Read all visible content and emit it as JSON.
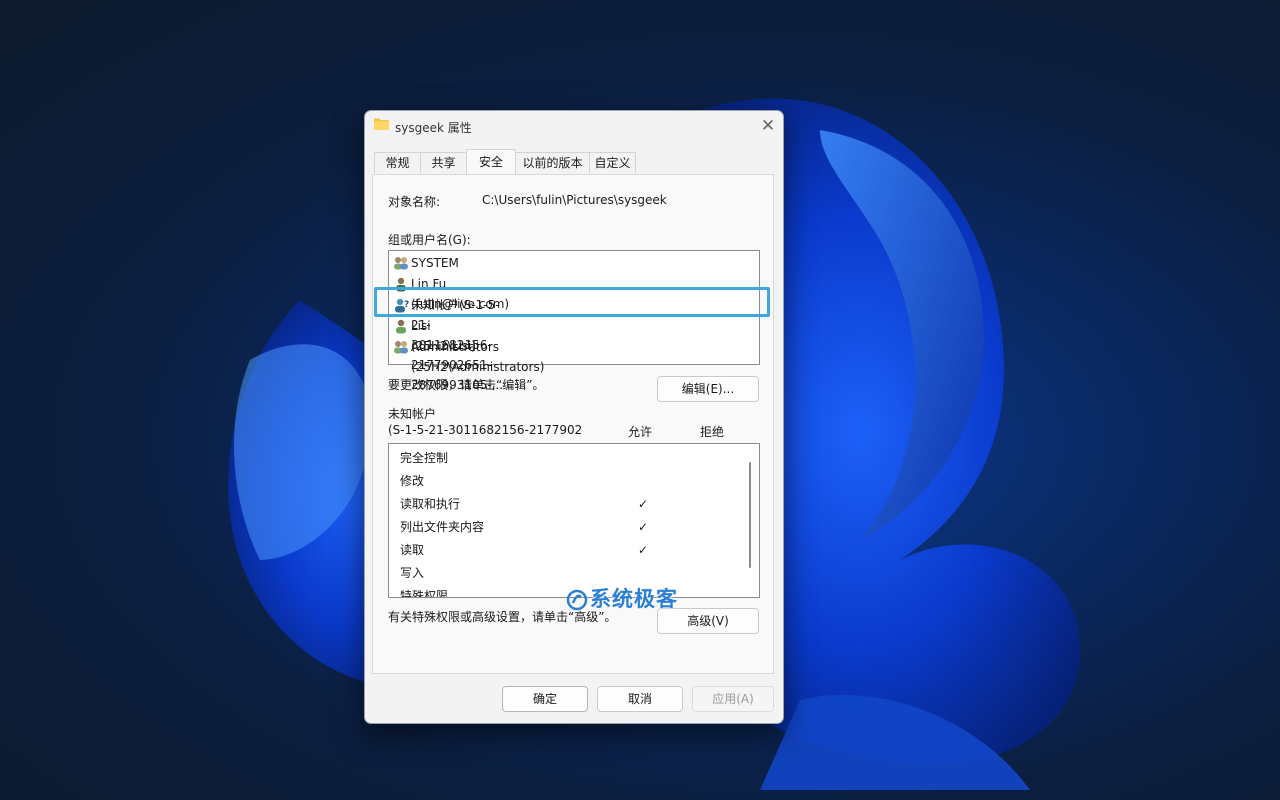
{
  "window": {
    "title": "sysgeek 属性",
    "close_glyph": "✕"
  },
  "tabs": [
    {
      "label": "常规"
    },
    {
      "label": "共享"
    },
    {
      "label": "安全",
      "active": true
    },
    {
      "label": "以前的版本"
    },
    {
      "label": "自定义"
    }
  ],
  "security": {
    "object_name_label": "对象名称:",
    "object_name_value": "C:\\Users\\fulin\\Pictures\\sysgeek",
    "group_label": "组或用户名(G):",
    "users": [
      {
        "label": "SYSTEM",
        "icon": "group-icon"
      },
      {
        "label": "Lin Fu (fulin@live.com)",
        "icon": "user-icon"
      },
      {
        "label": "未知帐户(S-1-5-21-3011682156-2177902651-2876993105-...",
        "icon": "unknown-user-icon",
        "selected": true
      },
      {
        "label": "Lisi (25H2\\Lisi)",
        "icon": "user-icon"
      },
      {
        "label": "Administrators (25H2\\Administrators)",
        "icon": "group-icon"
      }
    ],
    "change_hint": "要更改权限，请单击“编辑”。",
    "edit_button": "编辑(E)...",
    "perm_for_line1": "未知帐户",
    "perm_for_line2": "(S-1-5-21-3011682156-2177902",
    "allow_header": "允许",
    "deny_header": "拒绝",
    "permissions": [
      {
        "label": "完全控制",
        "allow": "",
        "deny": ""
      },
      {
        "label": "修改",
        "allow": "",
        "deny": ""
      },
      {
        "label": "读取和执行",
        "allow": "✓",
        "deny": ""
      },
      {
        "label": "列出文件夹内容",
        "allow": "✓",
        "deny": ""
      },
      {
        "label": "读取",
        "allow": "✓",
        "deny": ""
      },
      {
        "label": "写入",
        "allow": "",
        "deny": ""
      },
      {
        "label": "特殊权限",
        "allow": "",
        "deny": ""
      }
    ],
    "advanced_hint": "有关特殊权限或高级设置，请单击“高级”。",
    "advanced_button": "高级(V)"
  },
  "footer": {
    "ok": "确定",
    "cancel": "取消",
    "apply": "应用(A)"
  },
  "watermark": {
    "text": "系统极客"
  },
  "colors": {
    "highlight": "#3fa7dc",
    "watermark": "#2a7fd4"
  }
}
